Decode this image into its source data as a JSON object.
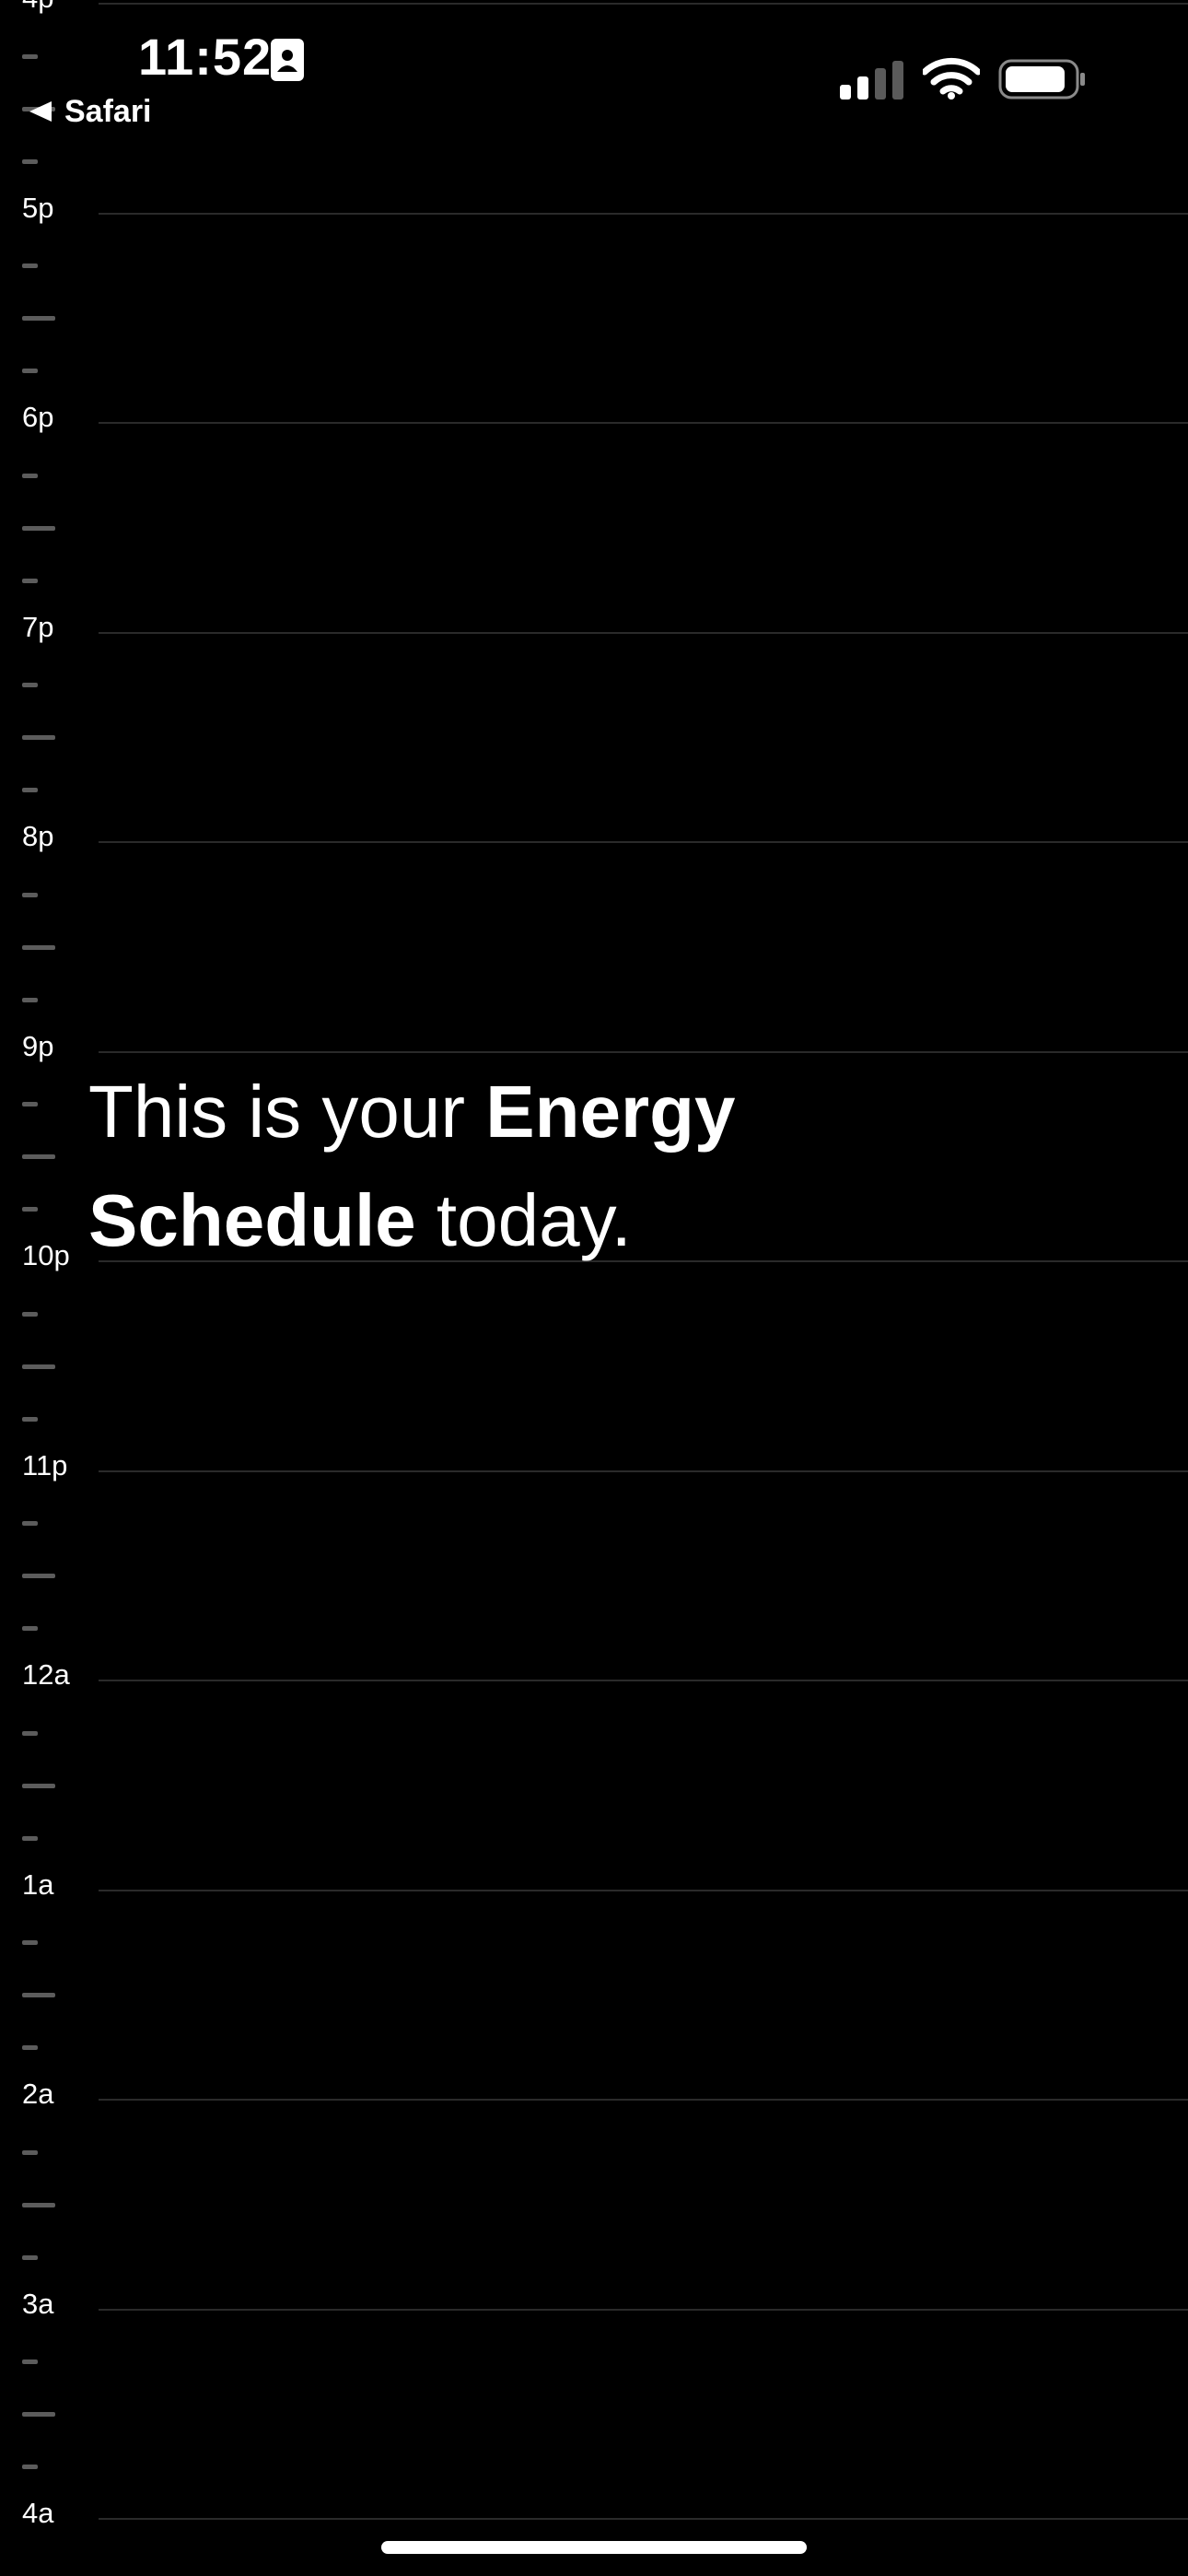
{
  "status_bar": {
    "time": "11:52",
    "back_label": "Safari",
    "icons": [
      "id-badge-icon",
      "back-arrow-icon",
      "cellular-signal-icon",
      "wifi-icon",
      "battery-icon"
    ]
  },
  "headline": {
    "part1": "This is your ",
    "bold1": "Energy",
    "bold2": "Schedule",
    "part2": " today."
  },
  "timeline": {
    "hours": [
      "4p",
      "5p",
      "6p",
      "7p",
      "8p",
      "9p",
      "10p",
      "11p",
      "12a",
      "1a",
      "2a",
      "3a",
      "4a"
    ]
  },
  "colors": {
    "background": "#000000",
    "text": "#ffffff",
    "gridline": "#2a2a2a",
    "tick": "#5c5c5c"
  }
}
